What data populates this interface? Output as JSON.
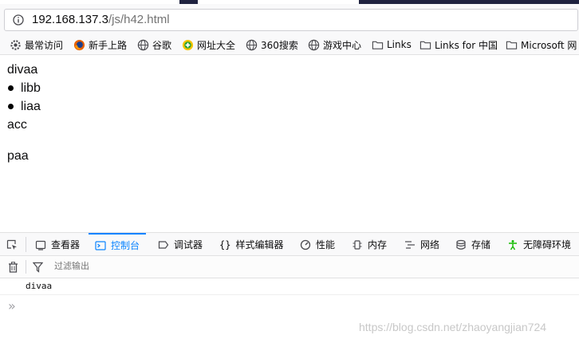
{
  "browser": {
    "url_host": "192.168.137.3",
    "url_path": "/js/h42.html"
  },
  "bookmarks": [
    {
      "label": "最常访问",
      "icon": "gear-icon"
    },
    {
      "label": "新手上路",
      "icon": "firefox-icon"
    },
    {
      "label": "谷歌",
      "icon": "globe-icon"
    },
    {
      "label": "网址大全",
      "icon": "site-directory-icon"
    },
    {
      "label": "360搜索",
      "icon": "globe-icon"
    },
    {
      "label": "游戏中心",
      "icon": "globe-icon"
    },
    {
      "label": "Links",
      "icon": "folder-icon"
    },
    {
      "label": "Links for 中国",
      "icon": "folder-icon"
    },
    {
      "label": "Microsoft 网",
      "icon": "folder-icon"
    }
  ],
  "page": {
    "div_text": "divaa",
    "list_items": [
      "libb",
      "liaa"
    ],
    "after_list": "acc",
    "paragraph": "paa"
  },
  "devtools": {
    "tabs": [
      {
        "label": "查看器",
        "icon": "inspector-icon"
      },
      {
        "label": "控制台",
        "icon": "console-icon",
        "active": true
      },
      {
        "label": "调试器",
        "icon": "debugger-icon"
      },
      {
        "label": "样式编辑器",
        "icon": "braces-icon"
      },
      {
        "label": "性能",
        "icon": "performance-icon"
      },
      {
        "label": "内存",
        "icon": "memory-icon"
      },
      {
        "label": "网络",
        "icon": "network-icon"
      },
      {
        "label": "存储",
        "icon": "storage-icon"
      },
      {
        "label": "无障碍环境",
        "icon": "accessibility-icon"
      }
    ],
    "filter_placeholder": "过滤输出",
    "console_log": "divaa",
    "prompt_glyph": "»"
  },
  "watermark": "https://blog.csdn.net/zhaoyangjian724",
  "colors": {
    "accent": "#0a84ff",
    "tab_dark": "#202340",
    "toolbar_bg": "#f9f9fa"
  }
}
